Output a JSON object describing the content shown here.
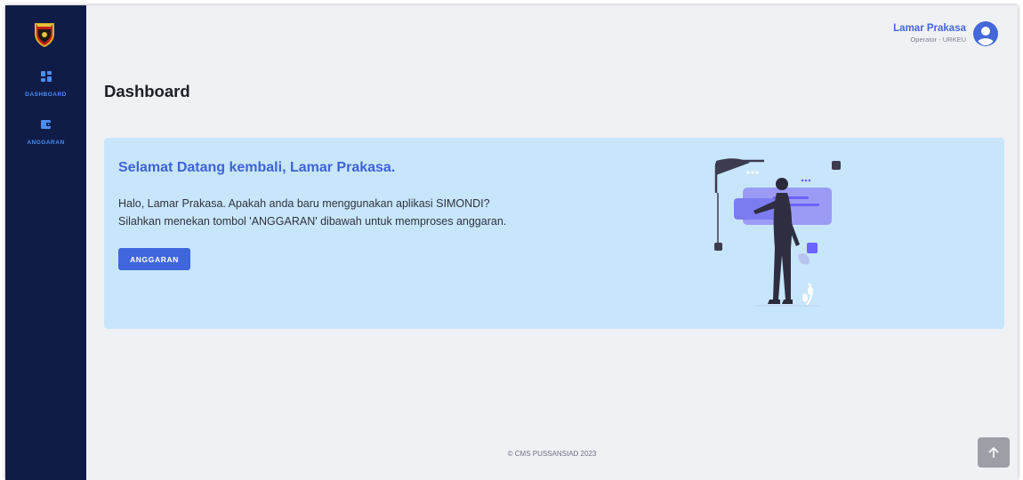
{
  "sidebar": {
    "items": [
      {
        "label": "DASHBOARD",
        "icon": "dashboard-grid-icon"
      },
      {
        "label": "ANGGARAN",
        "icon": "wallet-icon"
      }
    ],
    "logo": "police-emblem-logo"
  },
  "header": {
    "user_name": "Lamar Prakasa",
    "user_role": "Operator - URKEU",
    "avatar_icon": "user-circle-icon"
  },
  "page": {
    "title": "Dashboard"
  },
  "welcome": {
    "title": "Selamat Datang kembali, Lamar Prakasa.",
    "line1": "Halo, Lamar Prakasa. Apakah anda baru menggunakan aplikasi SIMONDI?",
    "line2": "Silahkan menekan tombol 'ANGGARAN' dibawah untuk memproses anggaran.",
    "button_label": "ANGGARAN"
  },
  "footer": {
    "text": "© CMS PUSSANSIAD 2023"
  },
  "colors": {
    "sidebar_bg": "#0f1c48",
    "accent": "#3f66dc",
    "card_bg": "#c8e6fb",
    "page_bg": "#f0f1f5"
  },
  "icons": {
    "scroll_top": "arrow-up-icon"
  }
}
